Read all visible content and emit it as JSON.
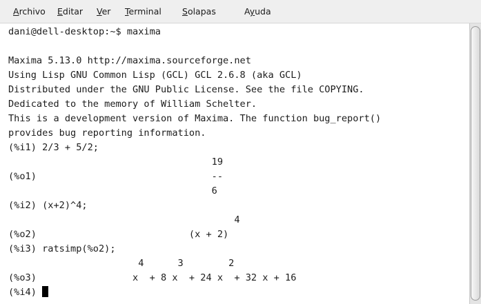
{
  "menu": {
    "items": [
      {
        "mnemonic": "A",
        "rest": "rchivo"
      },
      {
        "mnemonic": "E",
        "rest": "ditar"
      },
      {
        "mnemonic": "V",
        "rest": "er"
      },
      {
        "mnemonic": "T",
        "rest": "erminal"
      },
      {
        "mnemonic": "S",
        "rest": "olapas"
      },
      {
        "pre": "A",
        "mnemonic": "y",
        "rest": "uda"
      }
    ]
  },
  "terminal": {
    "lines": [
      "dani@dell-desktop:~$ maxima",
      "",
      "Maxima 5.13.0 http://maxima.sourceforge.net",
      "Using Lisp GNU Common Lisp (GCL) GCL 2.6.8 (aka GCL)",
      "Distributed under the GNU Public License. See the file COPYING.",
      "Dedicated to the memory of William Schelter.",
      "This is a development version of Maxima. The function bug_report()",
      "provides bug reporting information.",
      "(%i1) 2/3 + 5/2;",
      "                                    19",
      "(%o1)                               --",
      "                                    6",
      "(%i2) (x+2)^4;",
      "                                        4",
      "(%o2)                           (x + 2)",
      "(%i3) ratsimp(%o2);",
      "                       4      3        2",
      "(%o3)                 x  + 8 x  + 24 x  + 32 x + 16",
      "(%i4) "
    ]
  }
}
